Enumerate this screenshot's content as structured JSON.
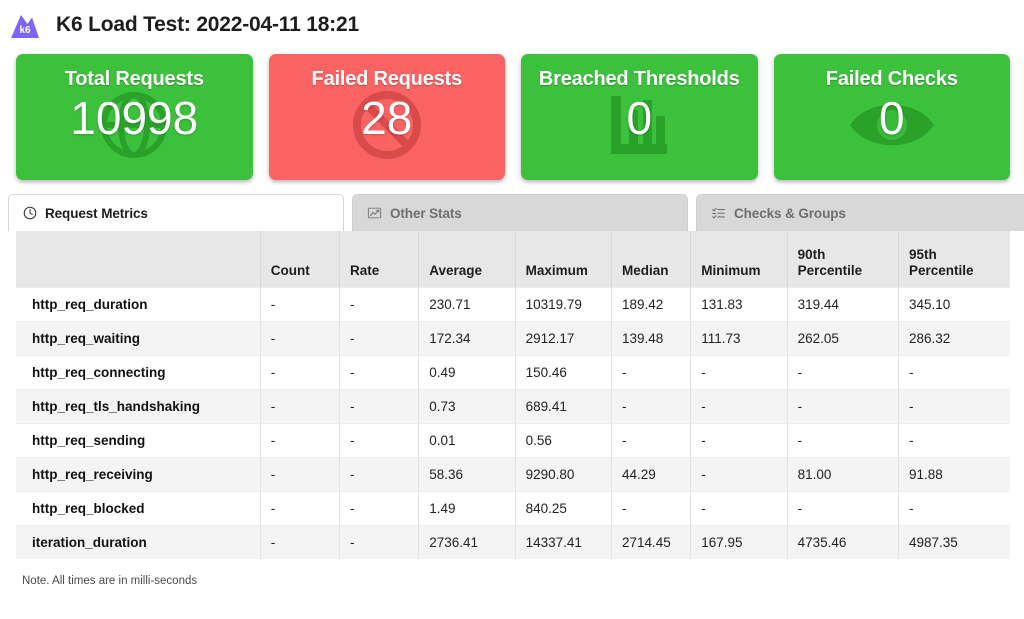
{
  "header": {
    "title": "K6 Load Test: 2022-04-11 18:21",
    "logo_icon": "k6-mountain-logo",
    "logo_text": "k6",
    "logo_color": "#7d64ff"
  },
  "colors": {
    "green": "#3cc13c",
    "red": "#fb6363",
    "tab_active_bg": "#ffffff",
    "tab_inactive_bg": "#d8d8d8",
    "header_row_bg": "#e7e7e7",
    "row_stripe_bg": "#f4f4f4"
  },
  "cards": [
    {
      "label": "Total Requests",
      "value": "10998",
      "status": "green",
      "icon": "globe-icon"
    },
    {
      "label": "Failed Requests",
      "value": "28",
      "status": "red",
      "icon": "ban-icon"
    },
    {
      "label": "Breached Thresholds",
      "value": "0",
      "status": "green",
      "icon": "bar-chart-icon"
    },
    {
      "label": "Failed Checks",
      "value": "0",
      "status": "green",
      "icon": "eye-icon"
    }
  ],
  "tabs": [
    {
      "label": "Request Metrics",
      "icon": "clock-icon",
      "active": true
    },
    {
      "label": "Other Stats",
      "icon": "chart-line-icon",
      "active": false
    },
    {
      "label": "Checks & Groups",
      "icon": "tasks-list-icon",
      "active": false
    }
  ],
  "table": {
    "columns": [
      "",
      "Count",
      "Rate",
      "Average",
      "Maximum",
      "Median",
      "Minimum",
      "90th Percentile",
      "95th Percentile"
    ],
    "rows": [
      {
        "metric": "http_req_duration",
        "count": "-",
        "rate": "-",
        "average": "230.71",
        "maximum": "10319.79",
        "median": "189.42",
        "minimum": "131.83",
        "p90": "319.44",
        "p95": "345.10"
      },
      {
        "metric": "http_req_waiting",
        "count": "-",
        "rate": "-",
        "average": "172.34",
        "maximum": "2912.17",
        "median": "139.48",
        "minimum": "111.73",
        "p90": "262.05",
        "p95": "286.32"
      },
      {
        "metric": "http_req_connecting",
        "count": "-",
        "rate": "-",
        "average": "0.49",
        "maximum": "150.46",
        "median": "-",
        "minimum": "-",
        "p90": "-",
        "p95": "-"
      },
      {
        "metric": "http_req_tls_handshaking",
        "count": "-",
        "rate": "-",
        "average": "0.73",
        "maximum": "689.41",
        "median": "-",
        "minimum": "-",
        "p90": "-",
        "p95": "-"
      },
      {
        "metric": "http_req_sending",
        "count": "-",
        "rate": "-",
        "average": "0.01",
        "maximum": "0.56",
        "median": "-",
        "minimum": "-",
        "p90": "-",
        "p95": "-"
      },
      {
        "metric": "http_req_receiving",
        "count": "-",
        "rate": "-",
        "average": "58.36",
        "maximum": "9290.80",
        "median": "44.29",
        "minimum": "-",
        "p90": "81.00",
        "p95": "91.88"
      },
      {
        "metric": "http_req_blocked",
        "count": "-",
        "rate": "-",
        "average": "1.49",
        "maximum": "840.25",
        "median": "-",
        "minimum": "-",
        "p90": "-",
        "p95": "-"
      },
      {
        "metric": "iteration_duration",
        "count": "-",
        "rate": "-",
        "average": "2736.41",
        "maximum": "14337.41",
        "median": "2714.45",
        "minimum": "167.95",
        "p90": "4735.46",
        "p95": "4987.35"
      }
    ]
  },
  "footer": {
    "note": "Note. All times are in milli-seconds"
  }
}
